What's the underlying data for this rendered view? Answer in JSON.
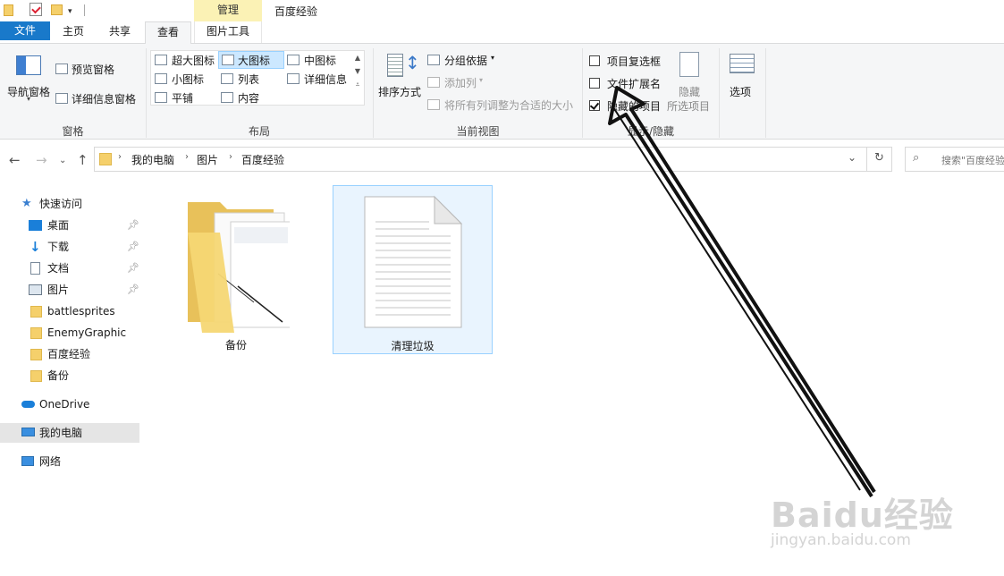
{
  "title_bar": {
    "context_tab": "管理",
    "window_title": "百度经验"
  },
  "tabs": {
    "file": "文件",
    "home": "主页",
    "share": "共享",
    "view": "查看",
    "picture_tools": "图片工具"
  },
  "ribbon": {
    "panes": {
      "nav_pane": "导航窗格",
      "preview_pane": "预览窗格",
      "details_pane": "详细信息窗格",
      "group": "窗格"
    },
    "layout": {
      "extra_large": "超大图标",
      "large": "大图标",
      "medium": "中图标",
      "small": "小图标",
      "list": "列表",
      "details": "详细信息",
      "tiles": "平铺",
      "content": "内容",
      "group": "布局"
    },
    "current_view": {
      "sort_by": "排序方式",
      "group_by": "分组依据",
      "add_columns": "添加列",
      "size_all_columns": "将所有列调整为合适的大小",
      "group": "当前视图"
    },
    "show_hide": {
      "item_checkboxes": "项目复选框",
      "file_extensions": "文件扩展名",
      "hidden_items": "隐藏的项目",
      "hide": "隐藏",
      "selected_items": "所选项目",
      "group": "显示/隐藏",
      "item_checkboxes_checked": false,
      "file_extensions_checked": false,
      "hidden_items_checked": true
    },
    "options": "选项"
  },
  "address": {
    "crumbs": [
      "我的电脑",
      "图片",
      "百度经验"
    ],
    "search_placeholder": "搜索\"百度经验\""
  },
  "nav": {
    "quick_access": "快速访问",
    "items": [
      {
        "label": "桌面",
        "pinned": true
      },
      {
        "label": "下载",
        "pinned": true
      },
      {
        "label": "文档",
        "pinned": true
      },
      {
        "label": "图片",
        "pinned": true
      },
      {
        "label": "battlesprites",
        "pinned": false
      },
      {
        "label": "EnemyGraphic",
        "pinned": false
      },
      {
        "label": "百度经验",
        "pinned": false
      },
      {
        "label": "备份",
        "pinned": false
      }
    ],
    "onedrive": "OneDrive",
    "this_pc": "我的电脑",
    "network": "网络"
  },
  "files": [
    {
      "name": "备份",
      "type": "folder"
    },
    {
      "name": "清理垃圾",
      "type": "text-file",
      "selected": true
    }
  ],
  "watermark": {
    "text": "Baidu经验",
    "url": "jingyan.baidu.com"
  },
  "colors": {
    "file_tab": "#1979ca",
    "context_tab": "#fbf2b5",
    "selection": "#cce8ff",
    "selected_nav": "#e5e5e5"
  }
}
